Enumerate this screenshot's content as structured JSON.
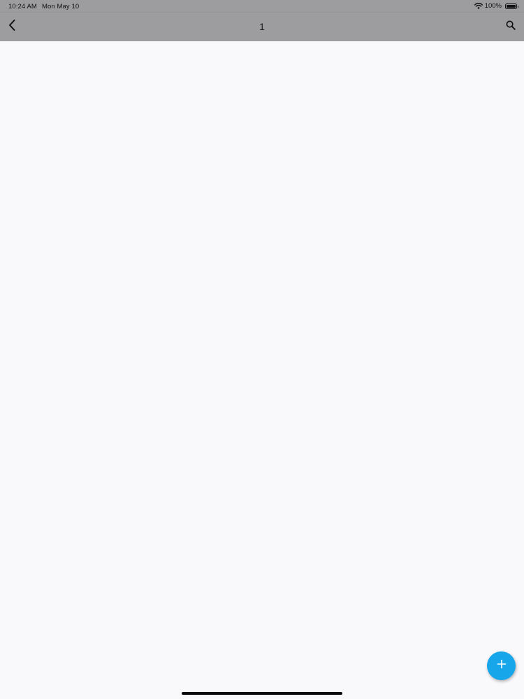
{
  "status_bar": {
    "time": "10:24 AM",
    "date": "Mon May 10",
    "battery_percent": "100%",
    "battery_level": 1.0,
    "icons": [
      "wifi-icon",
      "battery-icon"
    ]
  },
  "nav": {
    "title": "1",
    "back_icon": "chevron-left-icon",
    "search_icon": "search-icon"
  },
  "fab": {
    "icon": "plus-icon"
  },
  "colors": {
    "header_background": "#9d9c9f",
    "page_background": "#f9f8fb",
    "accent": "#17a6ea",
    "home_indicator": "#0b0b0b"
  }
}
